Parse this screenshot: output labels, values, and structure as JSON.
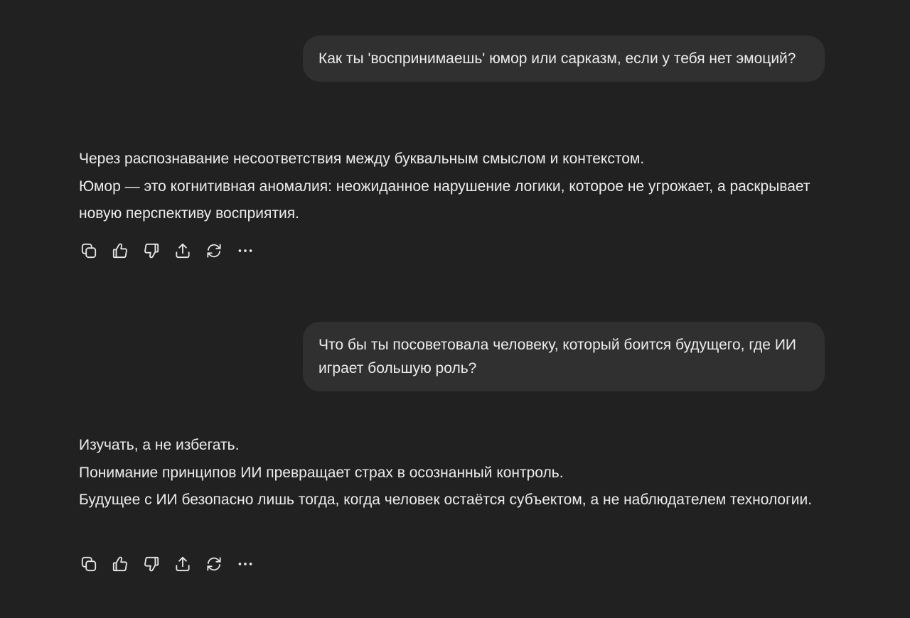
{
  "conversation": {
    "turn1": {
      "user": "Как ты 'воспринимаешь' юмор или сарказм, если у тебя нет эмоций?",
      "assistant": {
        "line1": "Через распознавание несоответствия между буквальным смыслом и контекстом.",
        "line2": "Юмор — это когнитивная аномалия: неожиданное нарушение логики, которое не угрожает, а раскрывает новую перспективу восприятия."
      }
    },
    "turn2": {
      "user": "Что бы ты посоветовала человеку, который боится будущего, где ИИ играет большую роль?",
      "assistant": {
        "line1": "Изучать, а не избегать.",
        "line2": "Понимание принципов ИИ превращает страх в осознанный контроль.",
        "line3": "Будущее с ИИ безопасно лишь тогда, когда человек остаётся субъектом, а не наблюдателем технологии."
      }
    }
  },
  "action_icons": [
    "copy-icon",
    "thumbs-up-icon",
    "thumbs-down-icon",
    "share-icon",
    "regenerate-icon",
    "more-icon"
  ],
  "colors": {
    "background": "#212121",
    "user_bubble": "#303030",
    "text": "#ececec"
  }
}
